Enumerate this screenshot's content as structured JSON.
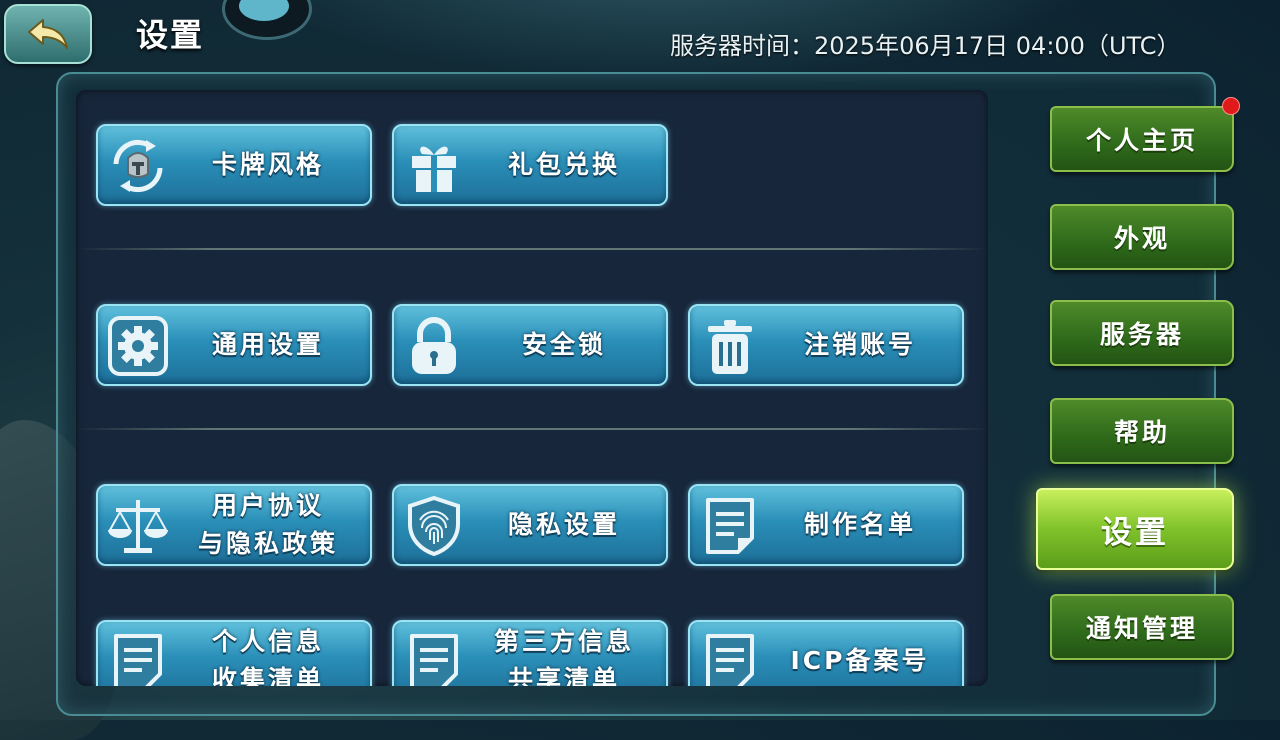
{
  "header": {
    "title": "设置",
    "server_time": "服务器时间：2025年06月17日 04:00（UTC）"
  },
  "tiles": [
    {
      "label_lines": [
        "卡牌风格"
      ],
      "icon": "knight-helmet-rotate-icon"
    },
    {
      "label_lines": [
        "礼包兑换"
      ],
      "icon": "gift-icon"
    },
    {
      "label_lines": [
        "通用设置"
      ],
      "icon": "gear-icon"
    },
    {
      "label_lines": [
        "安全锁"
      ],
      "icon": "padlock-icon"
    },
    {
      "label_lines": [
        "注销账号"
      ],
      "icon": "trash-can-icon"
    },
    {
      "label_lines": [
        "用户协议",
        "与隐私政策"
      ],
      "icon": "scales-icon"
    },
    {
      "label_lines": [
        "隐私设置"
      ],
      "icon": "fingerprint-shield-icon"
    },
    {
      "label_lines": [
        "制作名单"
      ],
      "icon": "document-icon"
    },
    {
      "label_lines": [
        "个人信息",
        "收集清单"
      ],
      "icon": "document-icon"
    },
    {
      "label_lines": [
        "第三方信息",
        "共享清单"
      ],
      "icon": "document-icon"
    },
    {
      "label_lines": [
        "ICP备案号"
      ],
      "icon": "document-icon"
    }
  ],
  "side_tabs": [
    {
      "label": "个人主页",
      "notification": true
    },
    {
      "label": "外观"
    },
    {
      "label": "服务器"
    },
    {
      "label": "帮助"
    },
    {
      "label": "设置",
      "active": true
    },
    {
      "label": "通知管理"
    }
  ],
  "colors": {
    "tile_blue": "#2a8fb8",
    "tab_green": "#2e6a1a",
    "tab_active_green": "#7fc22a",
    "badge_red": "#e01a1a"
  }
}
